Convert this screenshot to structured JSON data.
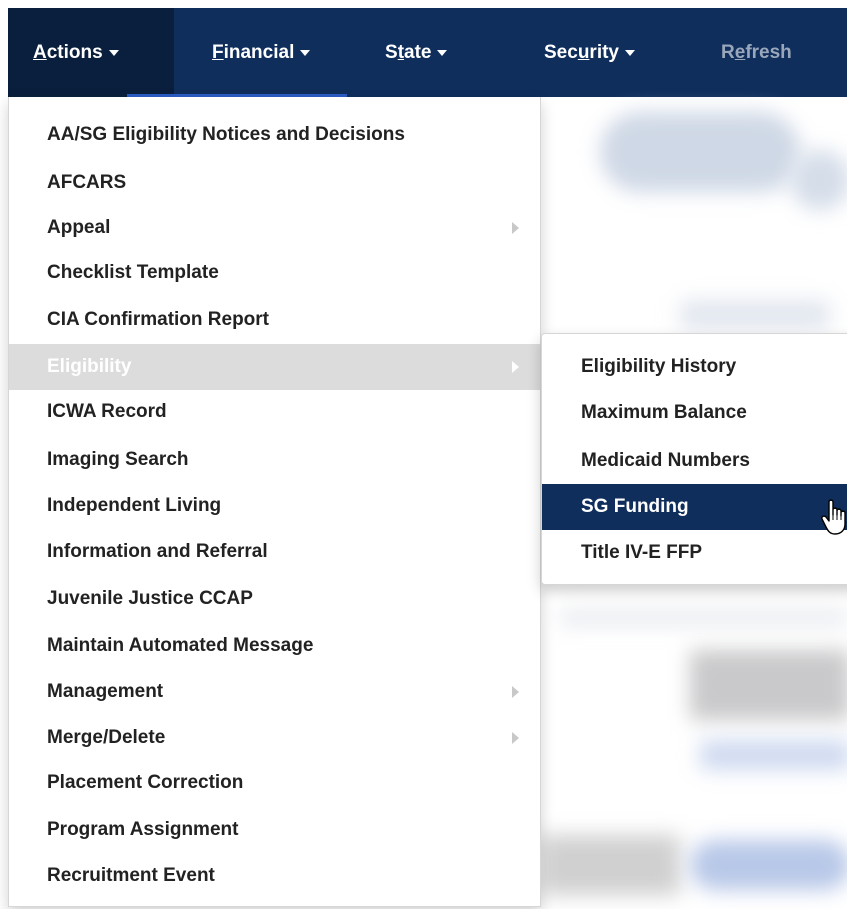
{
  "nav": {
    "items": [
      {
        "label": "Actions",
        "mnemonic": "A",
        "rest": "ctions",
        "has_caret": true,
        "state": "active"
      },
      {
        "label": "Financial",
        "mnemonic": "F",
        "rest": "inancial",
        "has_caret": true,
        "state": "normal"
      },
      {
        "label": "State",
        "pre": "S",
        "mnemonic": "t",
        "rest": "ate",
        "has_caret": true,
        "state": "normal"
      },
      {
        "label": "Security",
        "pre": "Sec",
        "mnemonic": "u",
        "rest": "rity",
        "has_caret": true,
        "state": "normal"
      },
      {
        "label": "Refresh",
        "pre": "R",
        "mnemonic": "e",
        "rest": "fresh",
        "has_caret": false,
        "state": "disabled"
      }
    ]
  },
  "menu": {
    "items": [
      {
        "label": "AA/SG Eligibility Notices and Decisions",
        "submenu": false
      },
      {
        "label": "AFCARS",
        "submenu": false
      },
      {
        "label": "Appeal",
        "submenu": true
      },
      {
        "label": "Checklist Template",
        "submenu": false
      },
      {
        "label": "CIA Confirmation Report",
        "submenu": false
      },
      {
        "label": "Eligibility",
        "submenu": true,
        "highlighted": true
      },
      {
        "label": "ICWA Record",
        "submenu": false
      },
      {
        "label": "Imaging Search",
        "submenu": false
      },
      {
        "label": "Independent Living",
        "submenu": false
      },
      {
        "label": "Information and Referral",
        "submenu": false
      },
      {
        "label": "Juvenile Justice CCAP",
        "submenu": false
      },
      {
        "label": "Maintain Automated Message",
        "submenu": false
      },
      {
        "label": "Management",
        "submenu": true
      },
      {
        "label": "Merge/Delete",
        "submenu": true
      },
      {
        "label": "Placement Correction",
        "submenu": false
      },
      {
        "label": "Program Assignment",
        "submenu": false
      },
      {
        "label": "Recruitment Event",
        "submenu": false
      }
    ]
  },
  "submenu": {
    "parent": "Eligibility",
    "items": [
      {
        "label": "Eligibility History"
      },
      {
        "label": "Maximum Balance"
      },
      {
        "label": "Medicaid Numbers"
      },
      {
        "label": "SG Funding",
        "selected": true
      },
      {
        "label": "Title IV-E FFP"
      }
    ]
  },
  "colors": {
    "nav_bg": "#0f2e5c",
    "highlight_bg": "#dcdcdc",
    "selected_bg": "#0f2e5c",
    "text": "#222222"
  },
  "icons": {
    "submenu_indicator": "triangle-right-icon",
    "dropdown_caret": "caret-down-icon",
    "pointer": "hand-pointer-icon"
  }
}
